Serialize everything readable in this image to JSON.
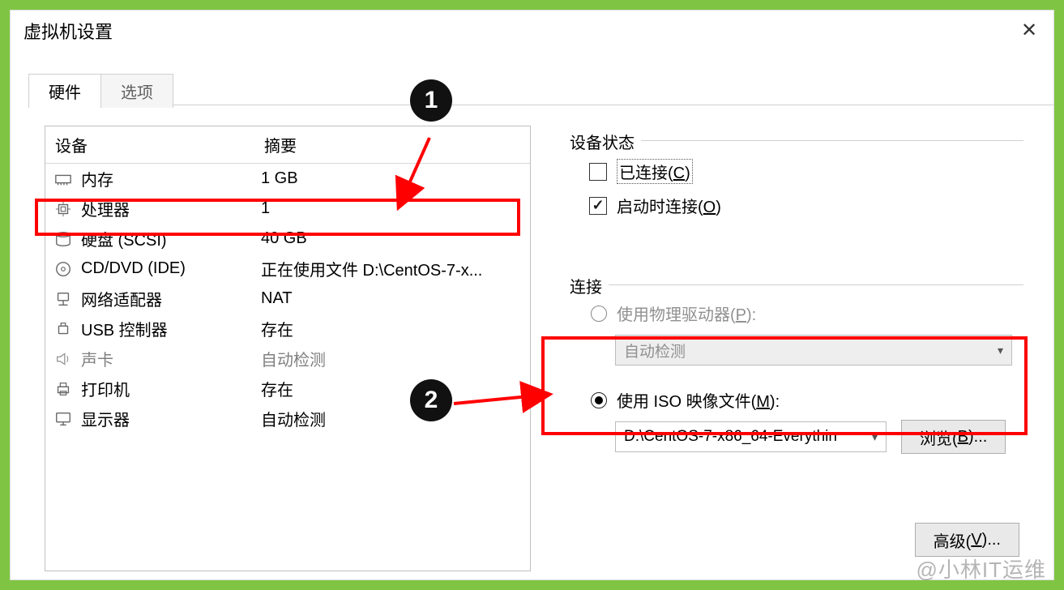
{
  "window_title": "虚拟机设置",
  "tabs": {
    "hardware": "硬件",
    "options": "选项"
  },
  "table": {
    "col_device": "设备",
    "col_summary": "摘要",
    "rows": [
      {
        "icon": "memory",
        "name": "内存",
        "summary": "1 GB",
        "dim": false
      },
      {
        "icon": "cpu",
        "name": "处理器",
        "summary": "1",
        "dim": false
      },
      {
        "icon": "disk",
        "name": "硬盘 (SCSI)",
        "summary": "40 GB",
        "dim": false
      },
      {
        "icon": "cd",
        "name": "CD/DVD (IDE)",
        "summary": "正在使用文件 D:\\CentOS-7-x...",
        "dim": false
      },
      {
        "icon": "net",
        "name": "网络适配器",
        "summary": "NAT",
        "dim": false
      },
      {
        "icon": "usb",
        "name": "USB 控制器",
        "summary": "存在",
        "dim": false
      },
      {
        "icon": "sound",
        "name": "声卡",
        "summary": "自动检测",
        "dim": true
      },
      {
        "icon": "printer",
        "name": "打印机",
        "summary": "存在",
        "dim": false
      },
      {
        "icon": "display",
        "name": "显示器",
        "summary": "自动检测",
        "dim": false
      }
    ]
  },
  "status": {
    "title": "设备状态",
    "connected_label": "已连接(",
    "connected_hotkey": "C",
    "connected_suffix": ")",
    "onstart_label": "启动时连接(",
    "onstart_hotkey": "O",
    "onstart_suffix": ")"
  },
  "connect": {
    "title": "连接",
    "phys_label": "使用物理驱动器(",
    "phys_hotkey": "P",
    "phys_suffix": "):",
    "phys_value": "自动检测",
    "iso_label": "使用 ISO 映像文件(",
    "iso_hotkey": "M",
    "iso_suffix": "):",
    "iso_value": "D:\\CentOS-7-x86_64-Everythin",
    "browse_label": "浏览(",
    "browse_hotkey": "B",
    "browse_suffix": ")..."
  },
  "advanced_label": "高级(",
  "advanced_hotkey": "V",
  "advanced_suffix": ")...",
  "badges": {
    "one": "1",
    "two": "2"
  },
  "watermark": "@小林IT运维"
}
